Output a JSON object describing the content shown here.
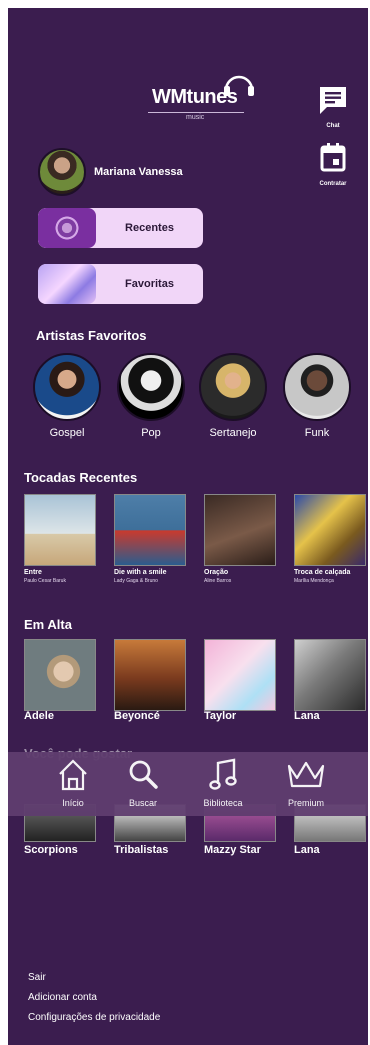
{
  "brand": {
    "name": "WMtunes",
    "sub": "music"
  },
  "side": {
    "chat": "Chat",
    "contract": "Contratar"
  },
  "user": {
    "name": "Mariana Vanessa"
  },
  "library": {
    "recent": "Recentes",
    "favorites": "Favoritas"
  },
  "artists": {
    "title": "Artistas Favoritos",
    "items": [
      {
        "label": "Gospel"
      },
      {
        "label": "Pop"
      },
      {
        "label": "Sertanejo"
      },
      {
        "label": "Funk"
      }
    ]
  },
  "recent": {
    "title": "Tocadas Recentes",
    "items": [
      {
        "title": "Entre",
        "artist": "Paulo Cesar Baruk"
      },
      {
        "title": "Die with a smile",
        "artist": "Lady Gaga & Bruno"
      },
      {
        "title": "Oração",
        "artist": "Aline Barros"
      },
      {
        "title": "Troca de calçada",
        "artist": "Marília Mendonça"
      }
    ]
  },
  "trending": {
    "title": "Em Alta",
    "items": [
      {
        "label": "Adele"
      },
      {
        "label": "Beyoncé"
      },
      {
        "label": "Taylor"
      },
      {
        "label": "Lana"
      }
    ]
  },
  "suggest": {
    "title": "Você pode gostar",
    "items": [
      {
        "label": "Scorpions"
      },
      {
        "label": "Tribalistas"
      },
      {
        "label": "Mazzy Star"
      },
      {
        "label": "Lana"
      }
    ]
  },
  "nav": {
    "home": "Início",
    "search": "Buscar",
    "library": "Biblioteca",
    "premium": "Premium"
  },
  "footer": {
    "logout": "Sair",
    "add": "Adicionar conta",
    "privacy": "Configurações de privacidade"
  },
  "colors": {
    "background": "#3b1d4f",
    "pill": "#f1d6f8",
    "navbar": "#5f3d6f"
  }
}
